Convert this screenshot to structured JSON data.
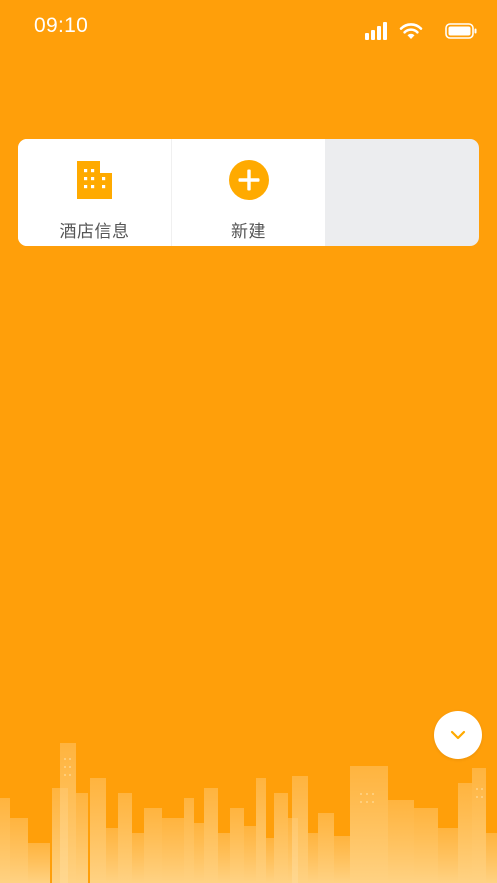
{
  "status_bar": {
    "time": "09:10",
    "icons": [
      "signal-icon",
      "wifi-icon",
      "battery-icon"
    ]
  },
  "menu": {
    "items": [
      {
        "label": "酒店信息",
        "icon": "building-icon"
      },
      {
        "label": "新建",
        "icon": "add-circle-icon"
      }
    ]
  },
  "fab": {
    "icon": "chevron-down-icon"
  },
  "colors": {
    "background": "#FF9F0A",
    "accent": "#FFAA00",
    "card": "#FFFFFF",
    "card_empty": "#ECEDEF",
    "label": "#555555"
  }
}
